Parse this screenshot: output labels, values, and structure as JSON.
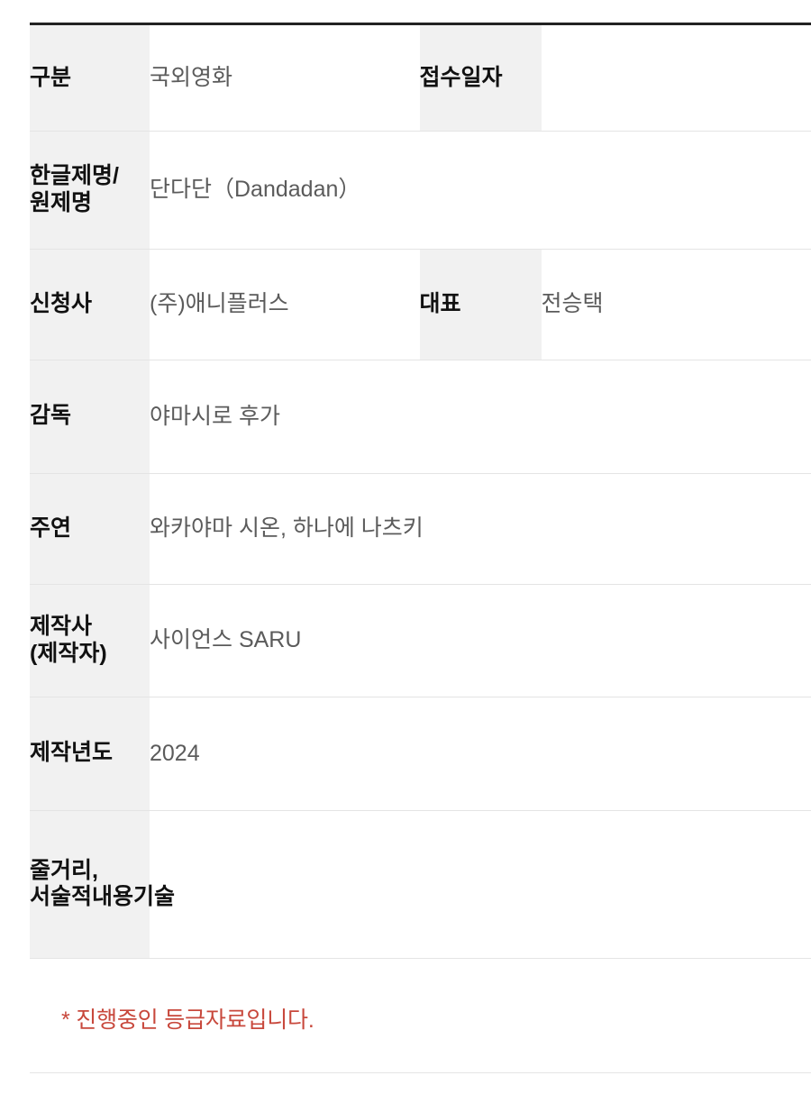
{
  "table": {
    "rows": [
      {
        "label": "구분",
        "value": "국외영화",
        "label2": "접수일자",
        "value2": ""
      },
      {
        "label": "한글제명/원제명",
        "value": "단다단（Dandadan）"
      },
      {
        "label": "신청사",
        "value": "(주)애니플러스",
        "label2": "대표",
        "value2": "전승택"
      },
      {
        "label": "감독",
        "value": "야마시로 후가"
      },
      {
        "label": "주연",
        "value": "와카야마 시온, 하나에 나츠키"
      },
      {
        "label": "제작사(제작자)",
        "value": "사이언스 SARU"
      },
      {
        "label": "제작년도",
        "value": "2024"
      },
      {
        "label": "줄거리, 서술적내용기술",
        "value": ""
      }
    ]
  },
  "notice": {
    "text": "* 진행중인 등급자료입니다.",
    "color": "#c8483c"
  },
  "colors": {
    "label_background": "#f1f1f1",
    "label_text": "#111111",
    "value_text": "#5b5b5b",
    "row_border": "#e4e4e4",
    "table_top_border": "#222222"
  }
}
